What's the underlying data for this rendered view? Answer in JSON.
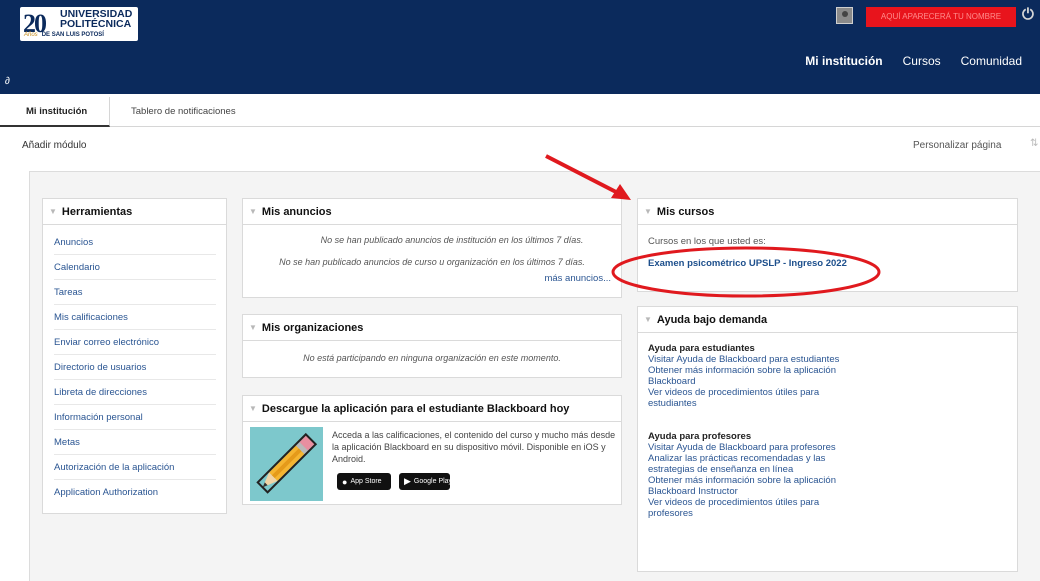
{
  "logo": {
    "mark": "20",
    "line1": "UNIVERSIDAD",
    "line2": "POLITÉCNICA",
    "line3a": "Años",
    "line3b": "DE SAN LUIS POTOSÍ"
  },
  "header": {
    "username": "AQUÍ APARECERÁ TU NOMBRE",
    "power_glyph": "⏻",
    "link_glyph": "∂",
    "tabs": [
      {
        "label": "Mi institución",
        "active": true
      },
      {
        "label": "Cursos",
        "active": false
      },
      {
        "label": "Comunidad",
        "active": false
      }
    ]
  },
  "subtabs": [
    {
      "label": "Mi institución"
    },
    {
      "label": "Tablero de notificaciones"
    }
  ],
  "toolbar": {
    "add_module": "Añadir módulo",
    "customize": "Personalizar página",
    "sort_glyph": "⇅"
  },
  "modules": {
    "tools": {
      "title": "Herramientas",
      "items": [
        "Anuncios",
        "Calendario",
        "Tareas",
        "Mis calificaciones",
        "Enviar correo electrónico",
        "Directorio de usuarios",
        "Libreta de direcciones",
        "Información personal",
        "Metas",
        "Autorización de la aplicación",
        "Application Authorization"
      ]
    },
    "announcements": {
      "title": "Mis anuncios",
      "line1": "No se han publicado anuncios de institución en los últimos 7 días.",
      "line2": "No se han publicado anuncios de curso u organización en los últimos 7 días.",
      "more": "más anuncios..."
    },
    "organizations": {
      "title": "Mis organizaciones",
      "text": "No está participando en ninguna organización en este momento."
    },
    "app": {
      "title": "Descargue la aplicación para el estudiante Blackboard hoy",
      "text": "Acceda a las calificaciones, el contenido del curso y mucho más desde la aplicación Blackboard en su dispositivo móvil. Disponible en iOS y Android.",
      "appstore_small": "Download on the",
      "appstore": "App Store",
      "googleplay_small": "GET IT ON",
      "googleplay": "Google Play"
    },
    "courses": {
      "title": "Mis cursos",
      "label": "Cursos en los que usted es:",
      "course": "Examen psicométrico UPSLP - Ingreso 2022"
    },
    "help": {
      "title": "Ayuda bajo demanda",
      "students_heading": "Ayuda para estudiantes",
      "students_links": [
        "Visitar Ayuda de Blackboard para estudiantes",
        "Obtener más información sobre la aplicación Blackboard",
        "Ver videos de procedimientos útiles para estudiantes"
      ],
      "teachers_heading": "Ayuda para profesores",
      "teachers_links": [
        "Visitar Ayuda de Blackboard para profesores",
        "Analizar las prácticas recomendadas y las estrategias de enseñanza en línea",
        "Obtener más información sobre la aplicación Blackboard Instructor",
        "Ver videos de procedimientos útiles para profesores"
      ]
    }
  },
  "colors": {
    "header_bg": "#0b2a5c",
    "link": "#2a5592",
    "name_badge": "#e8141c",
    "annotation": "#e0191e"
  }
}
